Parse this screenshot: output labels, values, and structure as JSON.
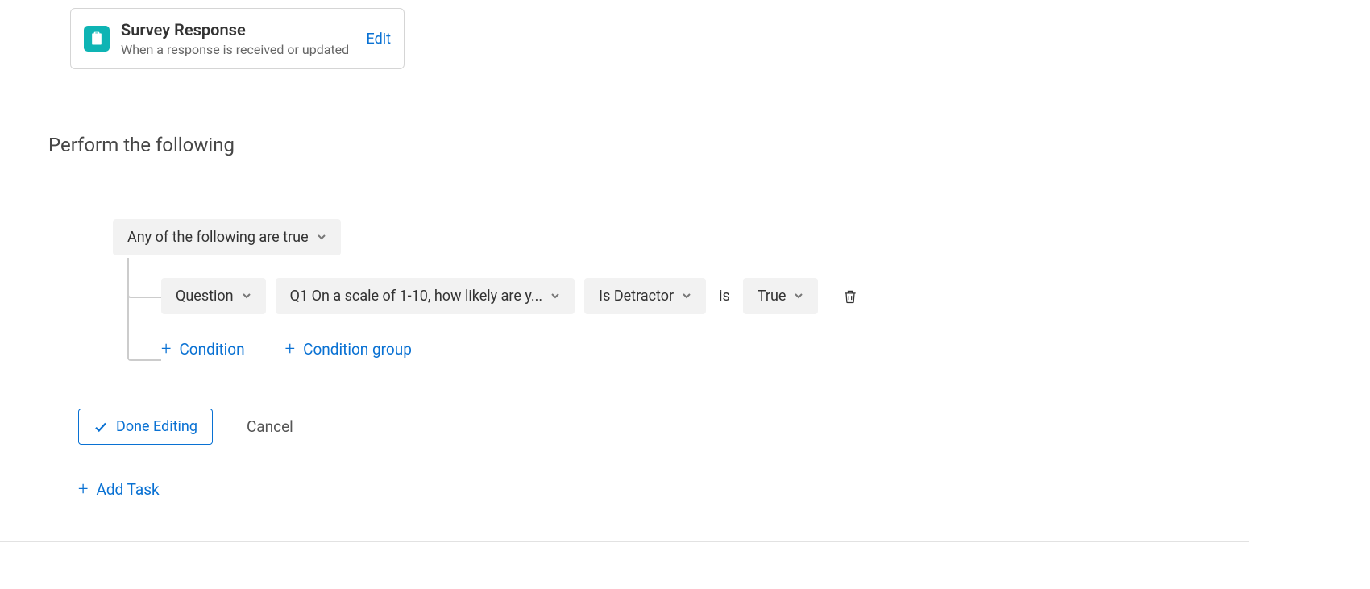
{
  "trigger": {
    "title": "Survey Response",
    "subtitle": "When a response is received or updated",
    "edit_label": "Edit"
  },
  "section_heading": "Perform the following",
  "condition_group": {
    "group_type_label": "Any of the following are true",
    "rule": {
      "selector_type": "Question",
      "question_label": "Q1 On a scale of 1-10, how likely are y...",
      "operator": "Is Detractor",
      "is_word": "is",
      "value": "True"
    },
    "add_condition_label": "Condition",
    "add_group_label": "Condition group"
  },
  "actions": {
    "done_label": "Done Editing",
    "cancel_label": "Cancel",
    "add_task_label": "Add Task"
  }
}
